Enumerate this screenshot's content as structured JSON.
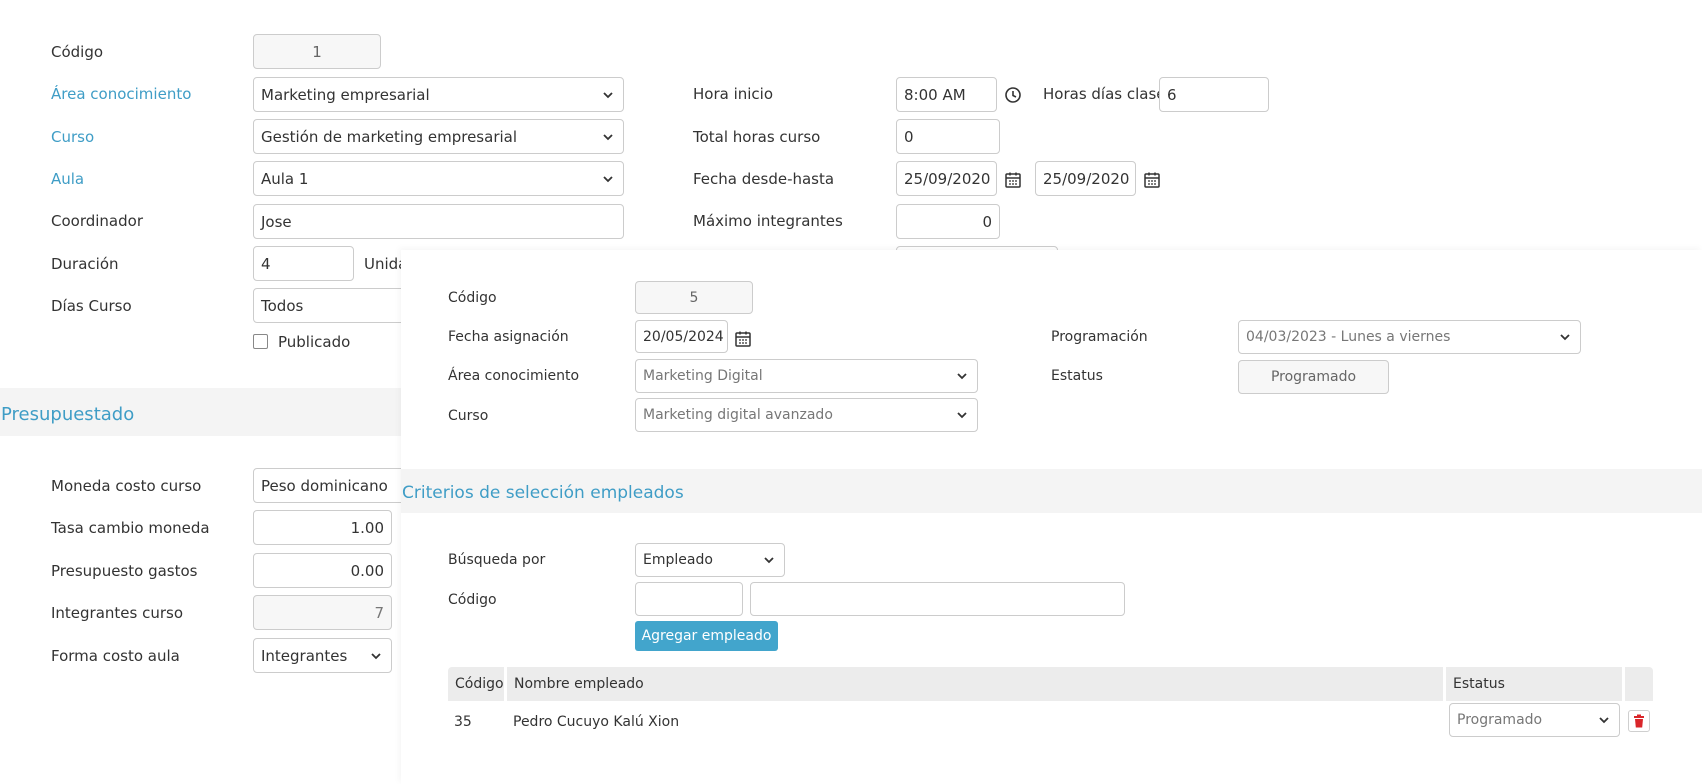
{
  "colors": {
    "accent": "#3f9dc6",
    "button": "#42a5cc",
    "delete": "#d9262a"
  },
  "course": {
    "codigo_label": "Código",
    "codigo": "1",
    "area_label": "Área conocimiento",
    "area": "Marketing empresarial",
    "curso_label": "Curso",
    "curso": "Gestión de marketing empresarial",
    "aula_label": "Aula",
    "aula": "Aula 1",
    "coordinador_label": "Coordinador",
    "coordinador": "Jose",
    "duracion_label": "Duración",
    "duracion": "4",
    "unidad_label": "Unida",
    "dias_label": "Días Curso",
    "dias": "Todos",
    "publicado_label": "Publicado",
    "hora_inicio_label": "Hora inicio",
    "hora_inicio": "8:00 AM",
    "horas_dias_label": "Horas días clase",
    "horas_dias": "6",
    "total_horas_label": "Total horas curso",
    "total_horas": "0",
    "fecha_label": "Fecha desde-hasta",
    "fecha_desde": "25/09/2020",
    "fecha_hasta": "25/09/2020",
    "maximo_label": "Máximo integrantes",
    "maximo": "0"
  },
  "presupuesto": {
    "title": "Presupuestado",
    "moneda_label": "Moneda costo curso",
    "moneda": "Peso dominicano",
    "tasa_label": "Tasa cambio moneda",
    "tasa": "1.00",
    "gastos_label": "Presupuesto gastos",
    "gastos": "0.00",
    "integrantes_label": "Integrantes curso",
    "integrantes": "7",
    "forma_label": "Forma costo aula",
    "forma": "Integrantes"
  },
  "asignacion": {
    "codigo_label": "Código",
    "codigo": "5",
    "fecha_label": "Fecha asignación",
    "fecha": "20/05/2024",
    "area_label": "Área conocimiento",
    "area": "Marketing Digital",
    "curso_label": "Curso",
    "curso": "Marketing digital avanzado",
    "programacion_label": "Programación",
    "programacion": "04/03/2023 - Lunes a viernes",
    "estatus_label": "Estatus",
    "estatus": "Programado"
  },
  "criterios": {
    "title": "Criterios de selección empleados",
    "busqueda_label": "Búsqueda por",
    "busqueda": "Empleado",
    "codigo_label": "Código",
    "codigo_value": "",
    "nombre_value": "",
    "agregar_button": "Agregar empleado"
  },
  "table": {
    "headers": [
      "Código",
      "Nombre empleado",
      "Estatus"
    ],
    "rows": [
      {
        "codigo": "35",
        "nombre": "Pedro Cucuyo Kalú Xion",
        "estatus": "Programado"
      }
    ]
  }
}
